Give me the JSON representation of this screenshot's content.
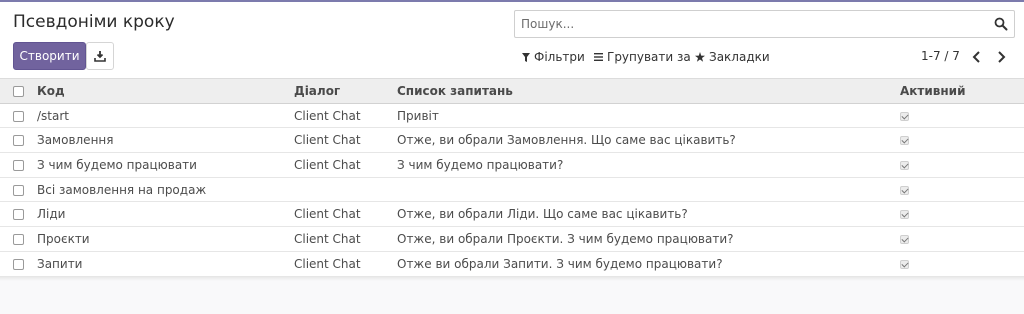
{
  "page": {
    "title": "Псевдоніми кроку"
  },
  "search": {
    "placeholder": "Пошук...",
    "icon": "search-icon"
  },
  "buttons": {
    "create_label": "Створити",
    "download_icon": "download-icon"
  },
  "filters": {
    "filters_label": "Фільтри",
    "group_by_label": "Групувати за",
    "favorites_label": "Закладки"
  },
  "pager": {
    "value": "1-7 / 7"
  },
  "table": {
    "headers": {
      "code": "Код",
      "dialog": "Діалог",
      "questions": "Список запитань",
      "active": "Активний"
    },
    "rows": [
      {
        "code": "/start",
        "dialog": "Client Chat",
        "questions": "Привіт",
        "active": true
      },
      {
        "code": "Замовлення",
        "dialog": "Client Chat",
        "questions": "Отже, ви обрали Замовлення. Що саме вас цікавить?",
        "active": true
      },
      {
        "code": "З чим будемо працювати",
        "dialog": "Client Chat",
        "questions": "З чим будемо працювати?",
        "active": true
      },
      {
        "code": "Всі замовлення на продаж",
        "dialog": "",
        "questions": "",
        "active": true
      },
      {
        "code": "Ліди",
        "dialog": "Client Chat",
        "questions": "Отже, ви обрали Ліди. Що саме вас цікавить?",
        "active": true
      },
      {
        "code": "Проєкти",
        "dialog": "Client Chat",
        "questions": "Отже, ви обрали Проєкти. З чим будемо працювати?",
        "active": true
      },
      {
        "code": "Запити",
        "dialog": "Client Chat",
        "questions": "Отже ви обрали Запити. З чим будемо працювати?",
        "active": true
      }
    ]
  },
  "colors": {
    "primary": "#71639e",
    "header_bg": "#eeeeee"
  }
}
